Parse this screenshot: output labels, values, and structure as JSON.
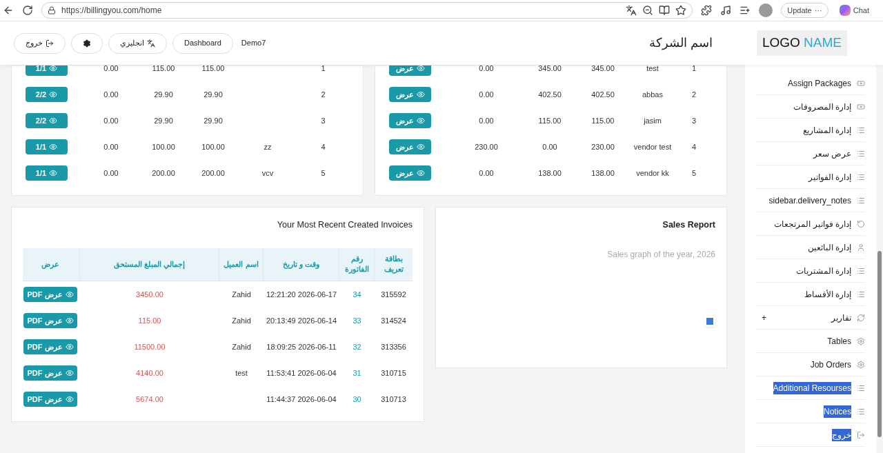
{
  "browser": {
    "url": "https://billingyou.com/home",
    "update_label": "Update",
    "update_more": "···",
    "chat_label": "Chat"
  },
  "header": {
    "logo_first": "LOGO",
    "logo_second": "NAME",
    "company": "اسم الشركة",
    "user": "Demo7",
    "buttons": [
      {
        "label": "Dashboard",
        "kind": "text"
      },
      {
        "label": "انجليزي",
        "kind": "language"
      },
      {
        "kind": "gear"
      },
      {
        "label": "خروج",
        "kind": "logout"
      }
    ]
  },
  "packages_table": {
    "rows": [
      {
        "button": "1/1",
        "cells": [
          "0.00",
          "115.00",
          "115.00",
          "",
          "1"
        ]
      },
      {
        "button": "2/2",
        "cells": [
          "0.00",
          "29.90",
          "29.90",
          "",
          "2"
        ]
      },
      {
        "button": "2/2",
        "cells": [
          "0.00",
          "29.90",
          "29.90",
          "",
          "3"
        ]
      },
      {
        "button": "1/1",
        "cells": [
          "0.00",
          "100.00",
          "100.00",
          "zz",
          "4"
        ]
      },
      {
        "button": "1/1",
        "cells": [
          "0.00",
          "200.00",
          "200.00",
          "vcv",
          "5"
        ]
      }
    ]
  },
  "vendors_table": {
    "rows": [
      {
        "button": "عرض",
        "cells": [
          "0.00",
          "345.00",
          "345.00",
          "test",
          "1"
        ]
      },
      {
        "button": "عرض",
        "cells": [
          "0.00",
          "402.50",
          "402.50",
          "abbas",
          "2"
        ]
      },
      {
        "button": "عرض",
        "cells": [
          "0.00",
          "115.00",
          "115.00",
          "jasim",
          "3"
        ]
      },
      {
        "button": "عرض",
        "cells": [
          "230.00",
          "0.00",
          "230.00",
          "vendor test",
          "4"
        ]
      },
      {
        "button": "عرض",
        "cells": [
          "0.00",
          "138.00",
          "138.00",
          "vendor kk",
          "5"
        ]
      }
    ]
  },
  "invoices": {
    "title": "Your Most Recent Created Invoices",
    "columns": [
      "بطاقة تعريف",
      "رقم الفاتورة",
      "وقت و تاريخ",
      "اسم العميل",
      "إجمالي المبلغ المستحق",
      "عرض"
    ],
    "rows": [
      {
        "id": "315592",
        "number": "34",
        "datetime": "12:21:20 2026-06-17",
        "customer": "Zahid",
        "total": "3450.00",
        "button": "عرض PDF"
      },
      {
        "id": "314524",
        "number": "33",
        "datetime": "20:13:49 2026-06-14",
        "customer": "Zahid",
        "total": "115.00",
        "button": "عرض PDF"
      },
      {
        "id": "313356",
        "number": "32",
        "datetime": "18:09:25 2026-06-11",
        "customer": "Zahid",
        "total": "11500.00",
        "button": "عرض PDF"
      },
      {
        "id": "310715",
        "number": "31",
        "datetime": "11:53:41 2026-06-04",
        "customer": "test",
        "total": "4140.00",
        "button": "عرض PDF"
      },
      {
        "id": "310713",
        "number": "30",
        "datetime": "11:44:37 2026-06-04",
        "total": "5674.00",
        "button": "عرض PDF"
      }
    ]
  },
  "sales_report": {
    "title": "Sales Report",
    "subtitle": "Sales graph of the year, 2026"
  },
  "sidebar": {
    "items": [
      {
        "label": "Assign Packages",
        "kind": "cash",
        "highlighted": false
      },
      {
        "label": "إدارة المصروفات",
        "kind": "cash",
        "highlighted": false
      },
      {
        "label": "إدارة المشاريع",
        "kind": "list",
        "highlighted": false
      },
      {
        "label": "عرض سعر",
        "kind": "list",
        "highlighted": false
      },
      {
        "label": "إدارة الفواتير",
        "kind": "list",
        "highlighted": false
      },
      {
        "label": "sidebar.delivery_notes",
        "kind": "list",
        "highlighted": false
      },
      {
        "label": "إدارة فواتير المرتجعات",
        "kind": "undo",
        "highlighted": false
      },
      {
        "label": "إدارة البائعين",
        "kind": "user",
        "highlighted": false
      },
      {
        "label": "إدارة المشتريات",
        "kind": "list",
        "highlighted": false
      },
      {
        "label": "إدارة الأقساط",
        "kind": "list",
        "highlighted": false
      },
      {
        "label": "تقارير",
        "kind": "refresh",
        "highlighted": false,
        "toggle": "+"
      },
      {
        "label": "Tables",
        "kind": "gear",
        "highlighted": false
      },
      {
        "label": "Job Orders",
        "kind": "gear",
        "highlighted": false
      },
      {
        "label": "Additional Resourses",
        "kind": "list",
        "highlighted": true
      },
      {
        "label": "Notices",
        "kind": "list",
        "highlighted": true
      },
      {
        "label": "خروج",
        "kind": "logout",
        "highlighted": true
      }
    ]
  }
}
